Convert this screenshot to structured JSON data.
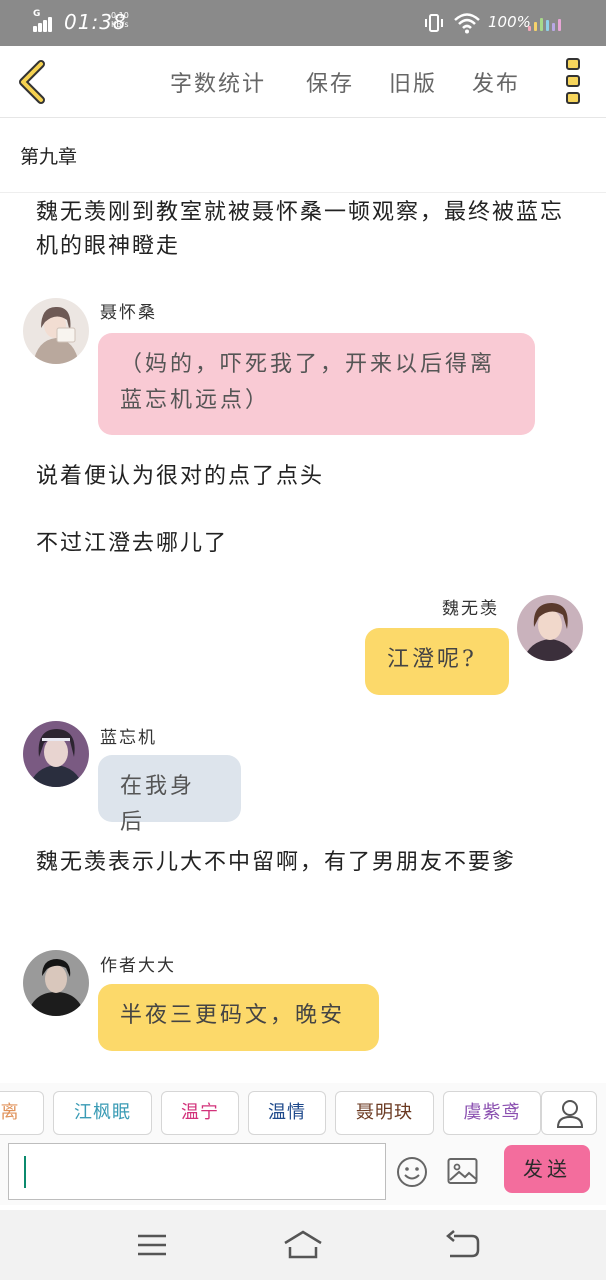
{
  "status_bar": {
    "network": "G",
    "time": "01:38",
    "speed_value": "0.10",
    "speed_unit": "KB/s",
    "battery": "100%"
  },
  "toolbar": {
    "items": [
      "字数统计",
      "保存",
      "旧版",
      "发布"
    ]
  },
  "chapter": {
    "title": "第九章"
  },
  "messages": {
    "narration_1": "魏无羡刚到教室就被聂怀桑一顿观察，最终被蓝忘机的眼神瞪走",
    "nie_speaker": "聂怀桑",
    "nie_text": "（妈的，吓死我了，开来以后得离蓝忘机远点）",
    "narration_2": "说着便认为很对的点了点头",
    "narration_3": "不过江澄去哪儿了",
    "wei_speaker": "魏无羡",
    "wei_text": "江澄呢?",
    "lan_speaker": "蓝忘机",
    "lan_text": "在我身后",
    "narration_4": "魏无羡表示儿大不中留啊，有了男朋友不要爹",
    "author_speaker": "作者大大",
    "author_text": "半夜三更码文，晚安"
  },
  "characters": {
    "chips": [
      "离",
      "江枫眠",
      "温宁",
      "温情",
      "聂明玦",
      "虞紫鸢"
    ],
    "chip_colors": [
      "#e0925a",
      "#3a9bb5",
      "#d2317a",
      "#1f4a8c",
      "#6b3a22",
      "#8a4fb0"
    ]
  },
  "composer": {
    "placeholder": "",
    "send_label": "发送"
  },
  "colors": {
    "pink_bubble": "#f9cad4",
    "yellow_bubble": "#fcd96a",
    "gray_bubble": "#dde4ec",
    "send_button": "#f36d9d"
  },
  "icons": [
    "back-arrow-icon",
    "more-menu-icon",
    "user-icon",
    "emoji-icon",
    "image-icon",
    "menu-icon",
    "home-icon",
    "back-icon"
  ]
}
